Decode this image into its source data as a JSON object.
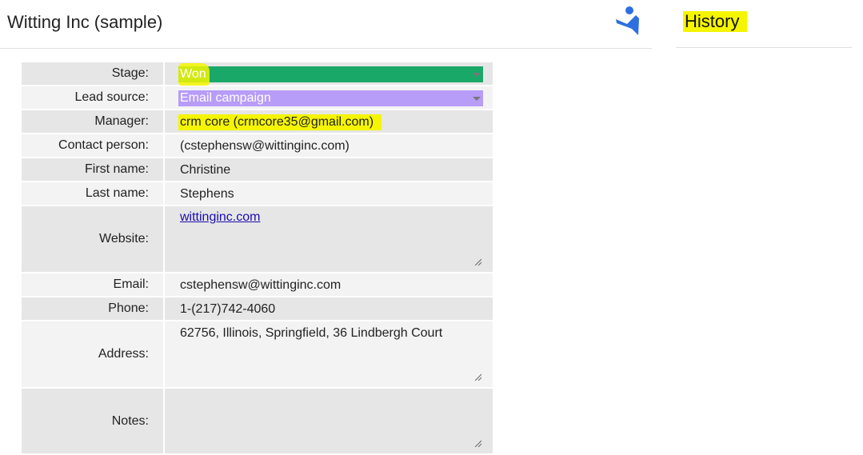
{
  "record": {
    "title": "Witting Inc (sample)"
  },
  "side_panel": {
    "title": "History"
  },
  "colors": {
    "stage_won": "#1aa868",
    "lead_source": "#b79cf8",
    "highlight": "#f5f500",
    "logo": "#2e6fe0"
  },
  "fields": {
    "stage": {
      "label": "Stage:",
      "value": "Won"
    },
    "lead_source": {
      "label": "Lead source:",
      "value": "Email campaign"
    },
    "manager": {
      "label": "Manager:",
      "value": "crm core (crmcore35@gmail.com)"
    },
    "contact_person": {
      "label": "Contact person:",
      "value": "(cstephensw@wittinginc.com)"
    },
    "first_name": {
      "label": "First name:",
      "value": "Christine"
    },
    "last_name": {
      "label": "Last name:",
      "value": "Stephens"
    },
    "website": {
      "label": "Website:",
      "value": "wittinginc.com"
    },
    "email": {
      "label": "Email:",
      "value": "cstephensw@wittinginc.com"
    },
    "phone": {
      "label": "Phone:",
      "value": "1-(217)742-4060"
    },
    "address": {
      "label": "Address:",
      "value": "62756, Illinois, Springfield, 36 Lindbergh Court"
    },
    "notes": {
      "label": "Notes:",
      "value": ""
    }
  }
}
